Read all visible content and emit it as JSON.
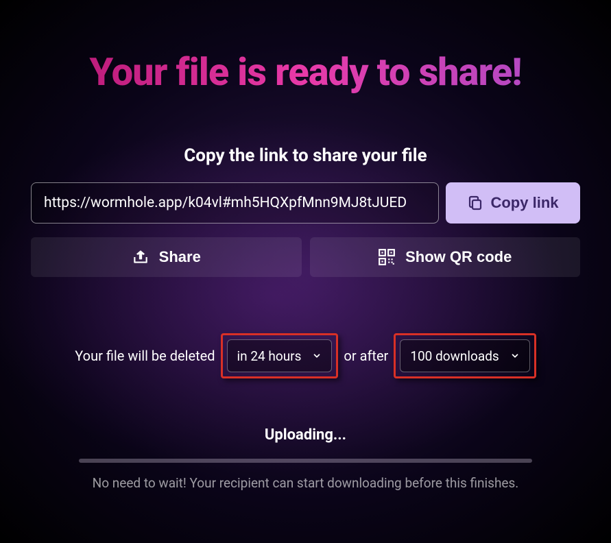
{
  "title": "Your file is ready to share!",
  "subtitle": "Copy the link to share your file",
  "link_url": "https://wormhole.app/k04vl#mh5HQXpfMnn9MJ8tJUED",
  "copy_button": "Copy link",
  "share_button": "Share",
  "qr_button": "Show QR code",
  "expiry": {
    "prefix": "Your file will be deleted",
    "time_option": "in 24 hours",
    "separator": "or after",
    "download_option": "100 downloads"
  },
  "upload": {
    "status": "Uploading...",
    "hint": "No need to wait! Your recipient can start downloading before this finishes."
  }
}
